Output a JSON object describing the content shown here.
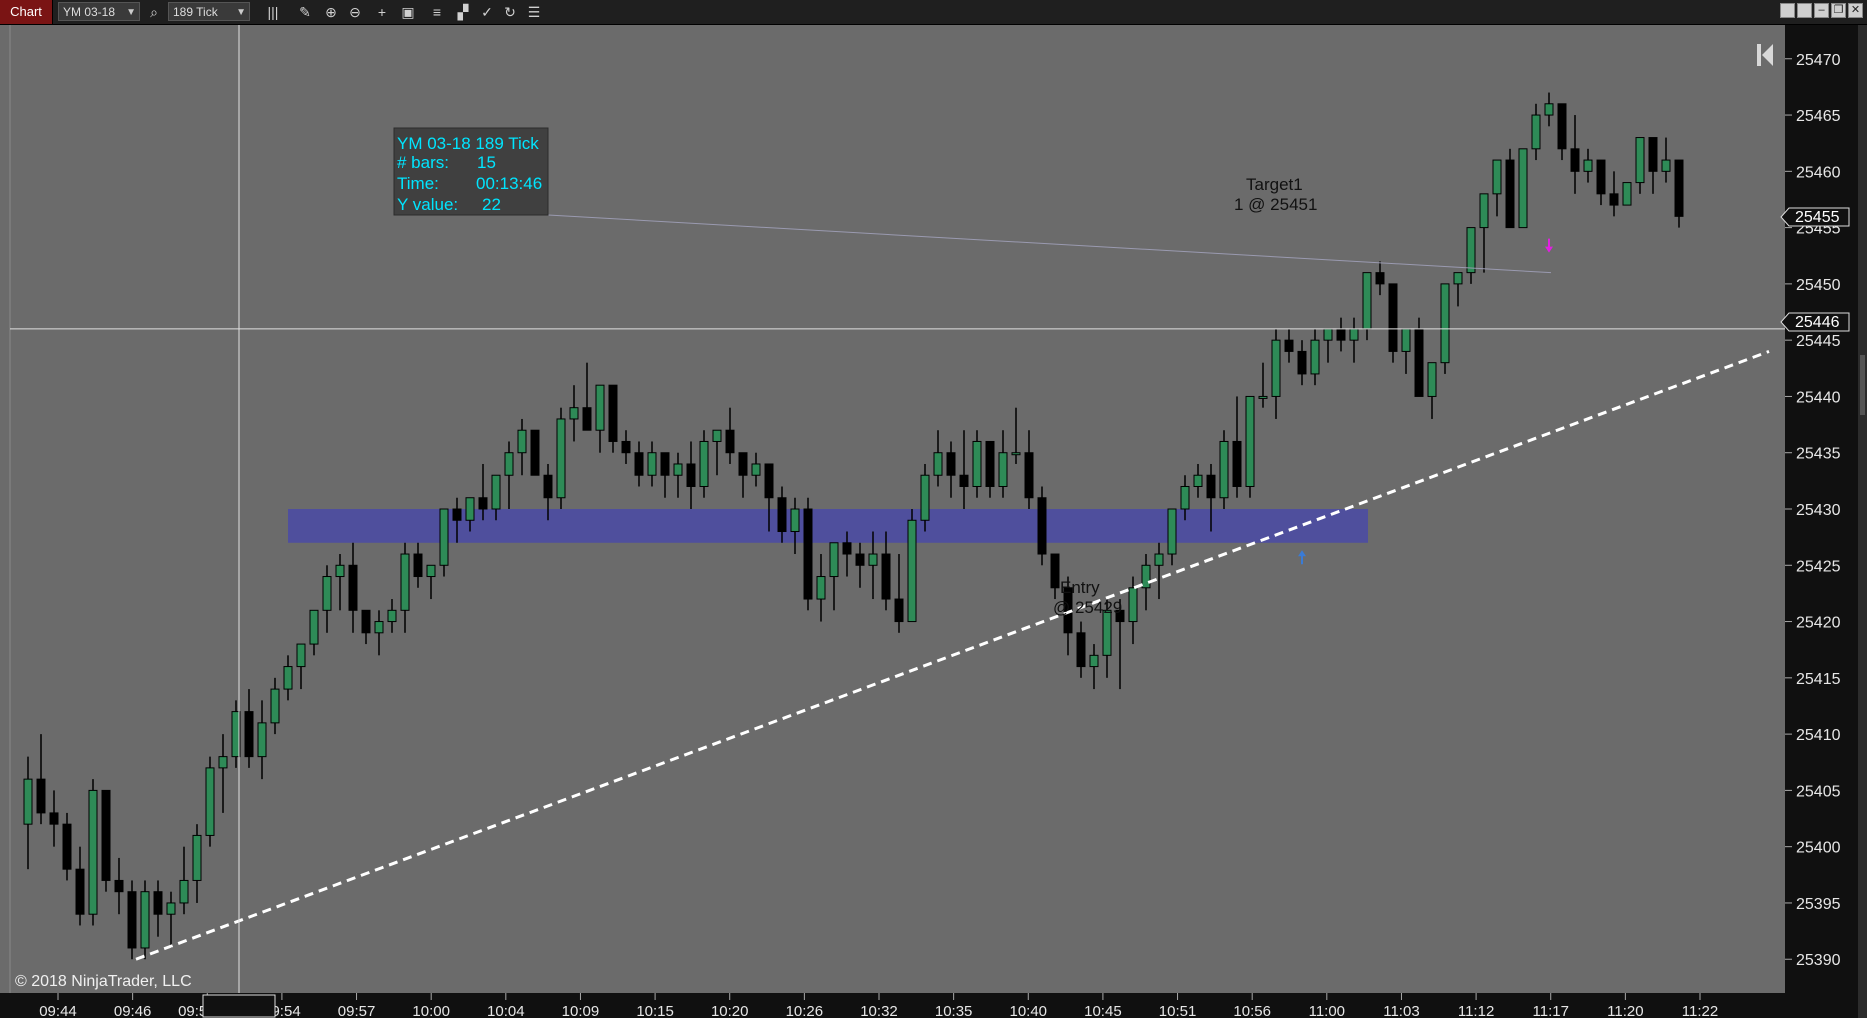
{
  "toolbar": {
    "tab_label": "Chart",
    "instrument": "YM 03-18",
    "interval": "189 Tick",
    "icons": [
      "search-icon",
      "bar-type-icon",
      "pencil-icon",
      "zoom-in-icon",
      "zoom-out-icon",
      "crosshair-icon",
      "properties-icon",
      "strategies-icon",
      "indicators-icon",
      "drawing-tools-icon",
      "refresh-icon",
      "list-icon"
    ],
    "window_buttons": [
      "tile-icon",
      "tile-icon",
      "minimize-icon",
      "restore-icon",
      "close-icon"
    ]
  },
  "chart_data": {
    "type": "candlestick",
    "instrument": "YM 03-18",
    "interval": "189 Tick",
    "ylim": [
      25387,
      25473
    ],
    "y_ticks": [
      25470,
      25465,
      25460,
      25455,
      25450,
      25445,
      25440,
      25435,
      25430,
      25425,
      25420,
      25415,
      25410,
      25405,
      25400,
      25395,
      25390
    ],
    "x_tick_labels": [
      "09:44",
      "09:46",
      "09:52:30",
      "09:54",
      "09:57",
      "10:00",
      "10:04",
      "10:09",
      "10:15",
      "10:20",
      "10:26",
      "10:32",
      "10:35",
      "10:40",
      "10:45",
      "10:51",
      "10:56",
      "11:00",
      "11:03",
      "11:12",
      "11:17",
      "11:20",
      "11:22"
    ],
    "last_price_label": "25455",
    "crosshair_price_label": "25446",
    "candles": [
      {
        "o": 25402,
        "h": 25408,
        "l": 25398,
        "c": 25406
      },
      {
        "o": 25406,
        "h": 25410,
        "l": 25402,
        "c": 25403
      },
      {
        "o": 25403,
        "h": 25405,
        "l": 25400,
        "c": 25402
      },
      {
        "o": 25402,
        "h": 25403,
        "l": 25397,
        "c": 25398
      },
      {
        "o": 25398,
        "h": 25400,
        "l": 25393,
        "c": 25394
      },
      {
        "o": 25394,
        "h": 25406,
        "l": 25393,
        "c": 25405
      },
      {
        "o": 25405,
        "h": 25405,
        "l": 25396,
        "c": 25397
      },
      {
        "o": 25397,
        "h": 25399,
        "l": 25394,
        "c": 25396
      },
      {
        "o": 25396,
        "h": 25397,
        "l": 25390,
        "c": 25391
      },
      {
        "o": 25391,
        "h": 25397,
        "l": 25390,
        "c": 25396
      },
      {
        "o": 25396,
        "h": 25397,
        "l": 25392,
        "c": 25394
      },
      {
        "o": 25394,
        "h": 25396,
        "l": 25391,
        "c": 25395
      },
      {
        "o": 25395,
        "h": 25400,
        "l": 25394,
        "c": 25397
      },
      {
        "o": 25397,
        "h": 25402,
        "l": 25395,
        "c": 25401
      },
      {
        "o": 25401,
        "h": 25408,
        "l": 25400,
        "c": 25407
      },
      {
        "o": 25407,
        "h": 25410,
        "l": 25403,
        "c": 25408
      },
      {
        "o": 25408,
        "h": 25413,
        "l": 25407,
        "c": 25412
      },
      {
        "o": 25412,
        "h": 25414,
        "l": 25407,
        "c": 25408
      },
      {
        "o": 25408,
        "h": 25413,
        "l": 25406,
        "c": 25411
      },
      {
        "o": 25411,
        "h": 25415,
        "l": 25410,
        "c": 25414
      },
      {
        "o": 25414,
        "h": 25417,
        "l": 25413,
        "c": 25416
      },
      {
        "o": 25416,
        "h": 25418,
        "l": 25414,
        "c": 25418
      },
      {
        "o": 25418,
        "h": 25421,
        "l": 25417,
        "c": 25421
      },
      {
        "o": 25421,
        "h": 25425,
        "l": 25419,
        "c": 25424
      },
      {
        "o": 25424,
        "h": 25426,
        "l": 25421,
        "c": 25425
      },
      {
        "o": 25425,
        "h": 25427,
        "l": 25419,
        "c": 25421
      },
      {
        "o": 25421,
        "h": 25421,
        "l": 25418,
        "c": 25419
      },
      {
        "o": 25419,
        "h": 25421,
        "l": 25417,
        "c": 25420
      },
      {
        "o": 25420,
        "h": 25422,
        "l": 25419,
        "c": 25421
      },
      {
        "o": 25421,
        "h": 25427,
        "l": 25419,
        "c": 25426
      },
      {
        "o": 25426,
        "h": 25427,
        "l": 25423,
        "c": 25424
      },
      {
        "o": 25424,
        "h": 25425,
        "l": 25422,
        "c": 25425
      },
      {
        "o": 25425,
        "h": 25430,
        "l": 25424,
        "c": 25430
      },
      {
        "o": 25430,
        "h": 25431,
        "l": 25427,
        "c": 25429
      },
      {
        "o": 25429,
        "h": 25431,
        "l": 25428,
        "c": 25431
      },
      {
        "o": 25431,
        "h": 25434,
        "l": 25429,
        "c": 25430
      },
      {
        "o": 25430,
        "h": 25433,
        "l": 25429,
        "c": 25433
      },
      {
        "o": 25433,
        "h": 25436,
        "l": 25430,
        "c": 25435
      },
      {
        "o": 25435,
        "h": 25438,
        "l": 25433,
        "c": 25437
      },
      {
        "o": 25437,
        "h": 25437,
        "l": 25433,
        "c": 25433
      },
      {
        "o": 25433,
        "h": 25434,
        "l": 25429,
        "c": 25431
      },
      {
        "o": 25431,
        "h": 25439,
        "l": 25430,
        "c": 25438
      },
      {
        "o": 25438,
        "h": 25441,
        "l": 25436,
        "c": 25439
      },
      {
        "o": 25439,
        "h": 25443,
        "l": 25438,
        "c": 25437
      },
      {
        "o": 25437,
        "h": 25440,
        "l": 25435,
        "c": 25441
      },
      {
        "o": 25441,
        "h": 25441,
        "l": 25435,
        "c": 25436
      },
      {
        "o": 25436,
        "h": 25437,
        "l": 25434,
        "c": 25435
      },
      {
        "o": 25435,
        "h": 25436,
        "l": 25432,
        "c": 25433
      },
      {
        "o": 25433,
        "h": 25436,
        "l": 25432,
        "c": 25435
      },
      {
        "o": 25435,
        "h": 25435,
        "l": 25431,
        "c": 25433
      },
      {
        "o": 25433,
        "h": 25435,
        "l": 25431,
        "c": 25434
      },
      {
        "o": 25434,
        "h": 25436,
        "l": 25430,
        "c": 25432
      },
      {
        "o": 25432,
        "h": 25437,
        "l": 25431,
        "c": 25436
      },
      {
        "o": 25436,
        "h": 25437,
        "l": 25433,
        "c": 25437
      },
      {
        "o": 25437,
        "h": 25439,
        "l": 25434,
        "c": 25435
      },
      {
        "o": 25435,
        "h": 25435,
        "l": 25431,
        "c": 25433
      },
      {
        "o": 25433,
        "h": 25435,
        "l": 25432,
        "c": 25434
      },
      {
        "o": 25434,
        "h": 25434,
        "l": 25428,
        "c": 25431
      },
      {
        "o": 25431,
        "h": 25432,
        "l": 25427,
        "c": 25428
      },
      {
        "o": 25428,
        "h": 25431,
        "l": 25426,
        "c": 25430
      },
      {
        "o": 25430,
        "h": 25431,
        "l": 25421,
        "c": 25422
      },
      {
        "o": 25422,
        "h": 25426,
        "l": 25420,
        "c": 25424
      },
      {
        "o": 25424,
        "h": 25426,
        "l": 25421,
        "c": 25427
      },
      {
        "o": 25427,
        "h": 25428,
        "l": 25424,
        "c": 25426
      },
      {
        "o": 25426,
        "h": 25427,
        "l": 25423,
        "c": 25425
      },
      {
        "o": 25425,
        "h": 25428,
        "l": 25422,
        "c": 25426
      },
      {
        "o": 25426,
        "h": 25428,
        "l": 25421,
        "c": 25422
      },
      {
        "o": 25422,
        "h": 25426,
        "l": 25419,
        "c": 25420
      },
      {
        "o": 25420,
        "h": 25430,
        "l": 25420,
        "c": 25429
      },
      {
        "o": 25429,
        "h": 25434,
        "l": 25428,
        "c": 25433
      },
      {
        "o": 25433,
        "h": 25437,
        "l": 25432,
        "c": 25435
      },
      {
        "o": 25435,
        "h": 25436,
        "l": 25431,
        "c": 25433
      },
      {
        "o": 25433,
        "h": 25437,
        "l": 25430,
        "c": 25432
      },
      {
        "o": 25432,
        "h": 25437,
        "l": 25431,
        "c": 25436
      },
      {
        "o": 25436,
        "h": 25436,
        "l": 25431,
        "c": 25432
      },
      {
        "o": 25432,
        "h": 25437,
        "l": 25431,
        "c": 25435
      },
      {
        "o": 25435,
        "h": 25439,
        "l": 25434,
        "c": 25435
      },
      {
        "o": 25435,
        "h": 25437,
        "l": 25430,
        "c": 25431
      },
      {
        "o": 25431,
        "h": 25432,
        "l": 25425,
        "c": 25426
      },
      {
        "o": 25426,
        "h": 25426,
        "l": 25422,
        "c": 25423
      },
      {
        "o": 25423,
        "h": 25424,
        "l": 25417,
        "c": 25419
      },
      {
        "o": 25419,
        "h": 25420,
        "l": 25415,
        "c": 25416
      },
      {
        "o": 25416,
        "h": 25418,
        "l": 25414,
        "c": 25417
      },
      {
        "o": 25417,
        "h": 25422,
        "l": 25415,
        "c": 25421
      },
      {
        "o": 25421,
        "h": 25422,
        "l": 25414,
        "c": 25420
      },
      {
        "o": 25420,
        "h": 25424,
        "l": 25418,
        "c": 25423
      },
      {
        "o": 25423,
        "h": 25426,
        "l": 25421,
        "c": 25425
      },
      {
        "o": 25425,
        "h": 25427,
        "l": 25422,
        "c": 25426
      },
      {
        "o": 25426,
        "h": 25430,
        "l": 25425,
        "c": 25430
      },
      {
        "o": 25430,
        "h": 25433,
        "l": 25429,
        "c": 25432
      },
      {
        "o": 25432,
        "h": 25434,
        "l": 25431,
        "c": 25433
      },
      {
        "o": 25433,
        "h": 25434,
        "l": 25428,
        "c": 25431
      },
      {
        "o": 25431,
        "h": 25437,
        "l": 25430,
        "c": 25436
      },
      {
        "o": 25436,
        "h": 25440,
        "l": 25431,
        "c": 25432
      },
      {
        "o": 25432,
        "h": 25440,
        "l": 25431,
        "c": 25440
      },
      {
        "o": 25440,
        "h": 25443,
        "l": 25439,
        "c": 25440
      },
      {
        "o": 25440,
        "h": 25446,
        "l": 25438,
        "c": 25445
      },
      {
        "o": 25445,
        "h": 25446,
        "l": 25443,
        "c": 25444
      },
      {
        "o": 25444,
        "h": 25445,
        "l": 25441,
        "c": 25442
      },
      {
        "o": 25442,
        "h": 25446,
        "l": 25441,
        "c": 25445
      },
      {
        "o": 25445,
        "h": 25446,
        "l": 25443,
        "c": 25446
      },
      {
        "o": 25446,
        "h": 25447,
        "l": 25444,
        "c": 25445
      },
      {
        "o": 25445,
        "h": 25447,
        "l": 25443,
        "c": 25446
      },
      {
        "o": 25446,
        "h": 25451,
        "l": 25445,
        "c": 25451
      },
      {
        "o": 25451,
        "h": 25452,
        "l": 25449,
        "c": 25450
      },
      {
        "o": 25450,
        "h": 25450,
        "l": 25443,
        "c": 25444
      },
      {
        "o": 25444,
        "h": 25446,
        "l": 25442,
        "c": 25446
      },
      {
        "o": 25446,
        "h": 25447,
        "l": 25440,
        "c": 25440
      },
      {
        "o": 25440,
        "h": 25442,
        "l": 25438,
        "c": 25443
      },
      {
        "o": 25443,
        "h": 25450,
        "l": 25442,
        "c": 25450
      },
      {
        "o": 25450,
        "h": 25451,
        "l": 25448,
        "c": 25451
      },
      {
        "o": 25451,
        "h": 25455,
        "l": 25450,
        "c": 25455
      },
      {
        "o": 25455,
        "h": 25458,
        "l": 25451,
        "c": 25458
      },
      {
        "o": 25458,
        "h": 25461,
        "l": 25456,
        "c": 25461
      },
      {
        "o": 25461,
        "h": 25462,
        "l": 25455,
        "c": 25455
      },
      {
        "o": 25455,
        "h": 25462,
        "l": 25455,
        "c": 25462
      },
      {
        "o": 25462,
        "h": 25466,
        "l": 25461,
        "c": 25465
      },
      {
        "o": 25465,
        "h": 25467,
        "l": 25464,
        "c": 25466
      },
      {
        "o": 25466,
        "h": 25466,
        "l": 25461,
        "c": 25462
      },
      {
        "o": 25462,
        "h": 25465,
        "l": 25458,
        "c": 25460
      },
      {
        "o": 25460,
        "h": 25462,
        "l": 25459,
        "c": 25461
      },
      {
        "o": 25461,
        "h": 25461,
        "l": 25457,
        "c": 25458
      },
      {
        "o": 25458,
        "h": 25460,
        "l": 25456,
        "c": 25457
      },
      {
        "o": 25457,
        "h": 25459,
        "l": 25457,
        "c": 25459
      },
      {
        "o": 25459,
        "h": 25463,
        "l": 25458,
        "c": 25463
      },
      {
        "o": 25463,
        "h": 25463,
        "l": 25458,
        "c": 25460
      },
      {
        "o": 25460,
        "h": 25463,
        "l": 25459,
        "c": 25461
      },
      {
        "o": 25461,
        "h": 25461,
        "l": 25455,
        "c": 25456
      }
    ],
    "zone": {
      "from": 25427,
      "to": 25430,
      "color": "#4a4aa6"
    },
    "trendline": {
      "start": {
        "bar": 8,
        "price": 25390
      },
      "end": {
        "bar": 132,
        "price": 25444
      }
    },
    "crosshair_price": 25446,
    "colors": {
      "up": "#2e8b57",
      "down": "#000000",
      "background": "#6b6b6b",
      "grid": "#7a7a7a",
      "axis": "#101010"
    }
  },
  "markers": {
    "entry": {
      "label": "Entry",
      "price_text": "@ 25429",
      "bar": 98
    },
    "target": {
      "label": "Target1",
      "price_text": "1 @ 25451",
      "bar": 117
    }
  },
  "info_box": {
    "title": "YM 03-18 189 Tick",
    "rows": [
      {
        "label": "# bars:",
        "value": "15"
      },
      {
        "label": "Time:",
        "value": "00:13:46"
      },
      {
        "label": "Y value:",
        "value": "22"
      }
    ]
  },
  "copyright": "© 2018 NinjaTrader, LLC"
}
